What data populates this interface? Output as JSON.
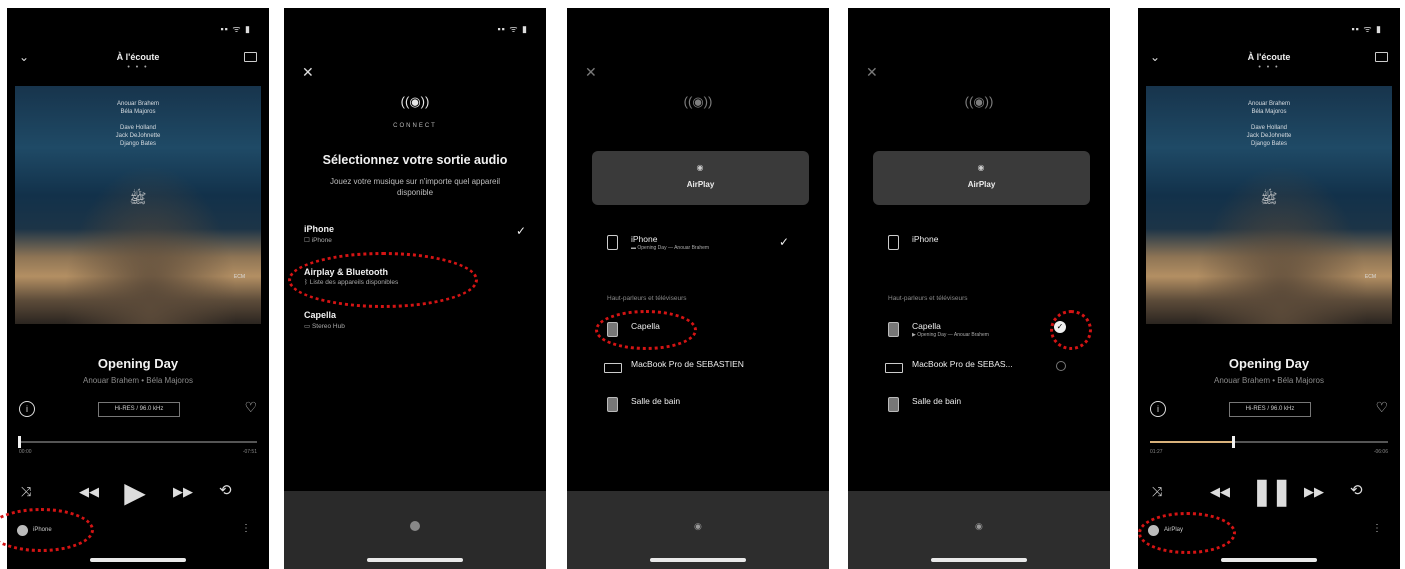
{
  "screen1": {
    "header_title": "À l'écoute",
    "header_dots": "• • •",
    "cover_lines": [
      "Anouar Brahem",
      "Béla Majoros",
      "",
      "Dave Holland",
      "Jack DeJohnette",
      "Django Bates"
    ],
    "cover_logo": "ﷺ",
    "cover_badge": "ECM",
    "track_title": "Opening Day",
    "artists": "Anouar Brahem • Béla Majoros",
    "quality": "Hi-RES / 96.0 kHz",
    "time_elapsed": "00:00",
    "time_remaining": "-07:51",
    "progress": 0.0,
    "output_label": "iPhone"
  },
  "screen2": {
    "connect_word": "CONNECT",
    "title": "Sélectionnez votre sortie audio",
    "subtitle": "Jouez votre musique sur n'importe quel appareil disponible",
    "options": [
      {
        "title": "iPhone",
        "sub": "☐ iPhone"
      },
      {
        "title": "Airplay & Bluetooth",
        "sub": "ᛒ Liste des appareils disponibles"
      },
      {
        "title": "Capella",
        "sub": "▭ Stereo Hub"
      }
    ]
  },
  "screen3": {
    "airplay_label": "AirPlay",
    "device_iphone": "iPhone",
    "device_iphone_sub": "▬ Opening Day — Anouar Brahem",
    "section": "Haut-parleurs et téléviseurs",
    "devices": [
      "Capella",
      "MacBook Pro de SEBASTIEN",
      "Salle de bain"
    ]
  },
  "screen4": {
    "airplay_label": "AirPlay",
    "device_iphone": "iPhone",
    "section": "Haut-parleurs et téléviseurs",
    "capella": "Capella",
    "capella_sub": "▶ Opening Day — Anouar Brahem",
    "macbook": "MacBook Pro de SEBAS...",
    "salle": "Salle de bain"
  },
  "screen5": {
    "header_title": "À l'écoute",
    "header_dots": "• • •",
    "cover_lines": [
      "Anouar Brahem",
      "Béla Majoros",
      "",
      "Dave Holland",
      "Jack DeJohnette",
      "Django Bates"
    ],
    "cover_logo": "ﷺ",
    "cover_badge": "ECM",
    "track_title": "Opening Day",
    "artists": "Anouar Brahem • Béla Majoros",
    "quality": "Hi-RES / 96.0 kHz",
    "time_elapsed": "01:27",
    "time_remaining": "-06:06",
    "progress": 0.35,
    "output_label": "AirPlay"
  },
  "colors": {
    "highlight": "#d41414",
    "progress": "#d9b27b"
  },
  "icons": [
    "chevron-down-icon",
    "cast-icon",
    "info-icon",
    "heart-icon",
    "shuffle-icon",
    "previous-icon",
    "play-icon",
    "pause-icon",
    "next-icon",
    "repeat-icon",
    "more-icon",
    "close-icon",
    "connect-logo-icon",
    "check-icon",
    "airplay-icon",
    "phone-icon",
    "speaker-icon",
    "laptop-icon"
  ]
}
